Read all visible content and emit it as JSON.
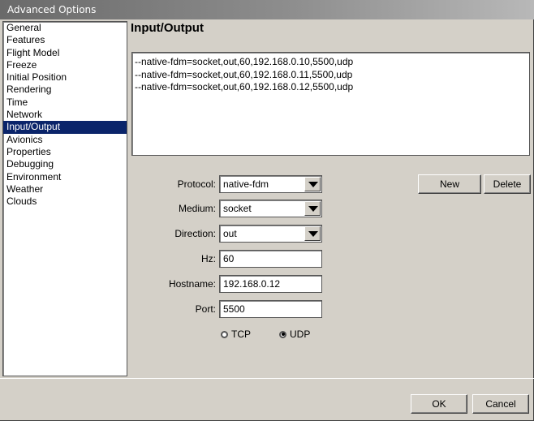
{
  "window": {
    "title": "Advanced Options"
  },
  "sidebar": {
    "items": [
      {
        "label": "General",
        "selected": false
      },
      {
        "label": "Features",
        "selected": false
      },
      {
        "label": "Flight Model",
        "selected": false
      },
      {
        "label": "Freeze",
        "selected": false
      },
      {
        "label": "Initial Position",
        "selected": false
      },
      {
        "label": "Rendering",
        "selected": false
      },
      {
        "label": "Time",
        "selected": false
      },
      {
        "label": "Network",
        "selected": false
      },
      {
        "label": "Input/Output",
        "selected": true
      },
      {
        "label": "Avionics",
        "selected": false
      },
      {
        "label": "Properties",
        "selected": false
      },
      {
        "label": "Debugging",
        "selected": false
      },
      {
        "label": "Environment",
        "selected": false
      },
      {
        "label": "Weather",
        "selected": false
      },
      {
        "label": "Clouds",
        "selected": false
      }
    ]
  },
  "panel": {
    "title": "Input/Output",
    "config_lines": [
      "--native-fdm=socket,out,60,192.168.0.10,5500,udp",
      "--native-fdm=socket,out,60,192.168.0.11,5500,udp",
      "--native-fdm=socket,out,60,192.168.0.12,5500,udp"
    ]
  },
  "form": {
    "protocol": {
      "label": "Protocol:",
      "value": "native-fdm"
    },
    "medium": {
      "label": "Medium:",
      "value": "socket"
    },
    "direction": {
      "label": "Direction:",
      "value": "out"
    },
    "hz": {
      "label": "Hz:",
      "value": "60"
    },
    "hostname": {
      "label": "Hostname:",
      "value": "192.168.0.12"
    },
    "port": {
      "label": "Port:",
      "value": "5500"
    },
    "transport": {
      "tcp": {
        "label": "TCP",
        "checked": false
      },
      "udp": {
        "label": "UDP",
        "checked": true
      }
    }
  },
  "buttons": {
    "new": "New",
    "delete": "Delete",
    "ok": "OK",
    "cancel": "Cancel"
  }
}
